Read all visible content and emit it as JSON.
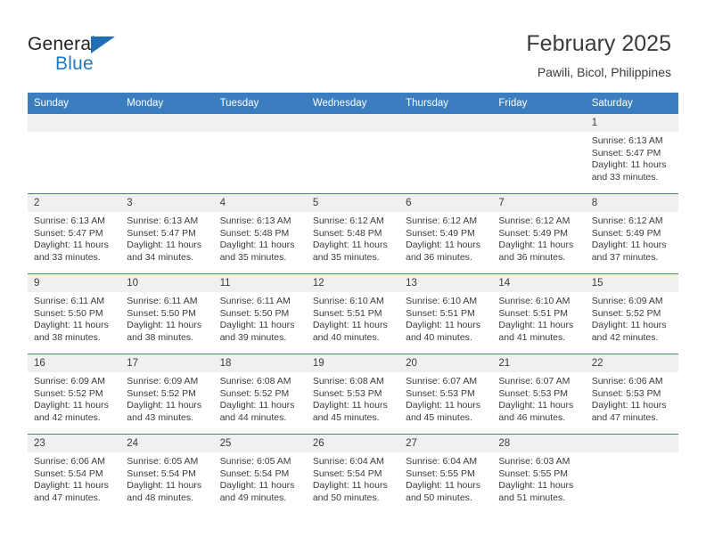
{
  "brand": {
    "name_part1": "General",
    "name_part2": "Blue",
    "triangle_color": "#1f6fb4",
    "blue_text_color": "#1f7ac4"
  },
  "header": {
    "title": "February 2025",
    "subtitle": "Pawili, Bicol, Philippines"
  },
  "theme": {
    "header_blue": "#3a7ebf",
    "date_band": "#f0f0f0",
    "text": "#3b3b3b"
  },
  "weekdays": [
    "Sunday",
    "Monday",
    "Tuesday",
    "Wednesday",
    "Thursday",
    "Friday",
    "Saturday"
  ],
  "weeks": [
    [
      {
        "day": "",
        "empty": true
      },
      {
        "day": "",
        "empty": true
      },
      {
        "day": "",
        "empty": true
      },
      {
        "day": "",
        "empty": true
      },
      {
        "day": "",
        "empty": true
      },
      {
        "day": "",
        "empty": true
      },
      {
        "day": "1",
        "sunrise": "Sunrise: 6:13 AM",
        "sunset": "Sunset: 5:47 PM",
        "daylight": "Daylight: 11 hours and 33 minutes."
      }
    ],
    [
      {
        "day": "2",
        "sunrise": "Sunrise: 6:13 AM",
        "sunset": "Sunset: 5:47 PM",
        "daylight": "Daylight: 11 hours and 33 minutes."
      },
      {
        "day": "3",
        "sunrise": "Sunrise: 6:13 AM",
        "sunset": "Sunset: 5:47 PM",
        "daylight": "Daylight: 11 hours and 34 minutes."
      },
      {
        "day": "4",
        "sunrise": "Sunrise: 6:13 AM",
        "sunset": "Sunset: 5:48 PM",
        "daylight": "Daylight: 11 hours and 35 minutes."
      },
      {
        "day": "5",
        "sunrise": "Sunrise: 6:12 AM",
        "sunset": "Sunset: 5:48 PM",
        "daylight": "Daylight: 11 hours and 35 minutes."
      },
      {
        "day": "6",
        "sunrise": "Sunrise: 6:12 AM",
        "sunset": "Sunset: 5:49 PM",
        "daylight": "Daylight: 11 hours and 36 minutes."
      },
      {
        "day": "7",
        "sunrise": "Sunrise: 6:12 AM",
        "sunset": "Sunset: 5:49 PM",
        "daylight": "Daylight: 11 hours and 36 minutes."
      },
      {
        "day": "8",
        "sunrise": "Sunrise: 6:12 AM",
        "sunset": "Sunset: 5:49 PM",
        "daylight": "Daylight: 11 hours and 37 minutes."
      }
    ],
    [
      {
        "day": "9",
        "sunrise": "Sunrise: 6:11 AM",
        "sunset": "Sunset: 5:50 PM",
        "daylight": "Daylight: 11 hours and 38 minutes."
      },
      {
        "day": "10",
        "sunrise": "Sunrise: 6:11 AM",
        "sunset": "Sunset: 5:50 PM",
        "daylight": "Daylight: 11 hours and 38 minutes."
      },
      {
        "day": "11",
        "sunrise": "Sunrise: 6:11 AM",
        "sunset": "Sunset: 5:50 PM",
        "daylight": "Daylight: 11 hours and 39 minutes."
      },
      {
        "day": "12",
        "sunrise": "Sunrise: 6:10 AM",
        "sunset": "Sunset: 5:51 PM",
        "daylight": "Daylight: 11 hours and 40 minutes."
      },
      {
        "day": "13",
        "sunrise": "Sunrise: 6:10 AM",
        "sunset": "Sunset: 5:51 PM",
        "daylight": "Daylight: 11 hours and 40 minutes."
      },
      {
        "day": "14",
        "sunrise": "Sunrise: 6:10 AM",
        "sunset": "Sunset: 5:51 PM",
        "daylight": "Daylight: 11 hours and 41 minutes."
      },
      {
        "day": "15",
        "sunrise": "Sunrise: 6:09 AM",
        "sunset": "Sunset: 5:52 PM",
        "daylight": "Daylight: 11 hours and 42 minutes."
      }
    ],
    [
      {
        "day": "16",
        "sunrise": "Sunrise: 6:09 AM",
        "sunset": "Sunset: 5:52 PM",
        "daylight": "Daylight: 11 hours and 42 minutes."
      },
      {
        "day": "17",
        "sunrise": "Sunrise: 6:09 AM",
        "sunset": "Sunset: 5:52 PM",
        "daylight": "Daylight: 11 hours and 43 minutes."
      },
      {
        "day": "18",
        "sunrise": "Sunrise: 6:08 AM",
        "sunset": "Sunset: 5:52 PM",
        "daylight": "Daylight: 11 hours and 44 minutes."
      },
      {
        "day": "19",
        "sunrise": "Sunrise: 6:08 AM",
        "sunset": "Sunset: 5:53 PM",
        "daylight": "Daylight: 11 hours and 45 minutes."
      },
      {
        "day": "20",
        "sunrise": "Sunrise: 6:07 AM",
        "sunset": "Sunset: 5:53 PM",
        "daylight": "Daylight: 11 hours and 45 minutes."
      },
      {
        "day": "21",
        "sunrise": "Sunrise: 6:07 AM",
        "sunset": "Sunset: 5:53 PM",
        "daylight": "Daylight: 11 hours and 46 minutes."
      },
      {
        "day": "22",
        "sunrise": "Sunrise: 6:06 AM",
        "sunset": "Sunset: 5:53 PM",
        "daylight": "Daylight: 11 hours and 47 minutes."
      }
    ],
    [
      {
        "day": "23",
        "sunrise": "Sunrise: 6:06 AM",
        "sunset": "Sunset: 5:54 PM",
        "daylight": "Daylight: 11 hours and 47 minutes."
      },
      {
        "day": "24",
        "sunrise": "Sunrise: 6:05 AM",
        "sunset": "Sunset: 5:54 PM",
        "daylight": "Daylight: 11 hours and 48 minutes."
      },
      {
        "day": "25",
        "sunrise": "Sunrise: 6:05 AM",
        "sunset": "Sunset: 5:54 PM",
        "daylight": "Daylight: 11 hours and 49 minutes."
      },
      {
        "day": "26",
        "sunrise": "Sunrise: 6:04 AM",
        "sunset": "Sunset: 5:54 PM",
        "daylight": "Daylight: 11 hours and 50 minutes."
      },
      {
        "day": "27",
        "sunrise": "Sunrise: 6:04 AM",
        "sunset": "Sunset: 5:55 PM",
        "daylight": "Daylight: 11 hours and 50 minutes."
      },
      {
        "day": "28",
        "sunrise": "Sunrise: 6:03 AM",
        "sunset": "Sunset: 5:55 PM",
        "daylight": "Daylight: 11 hours and 51 minutes."
      },
      {
        "day": "",
        "empty": true
      }
    ]
  ]
}
